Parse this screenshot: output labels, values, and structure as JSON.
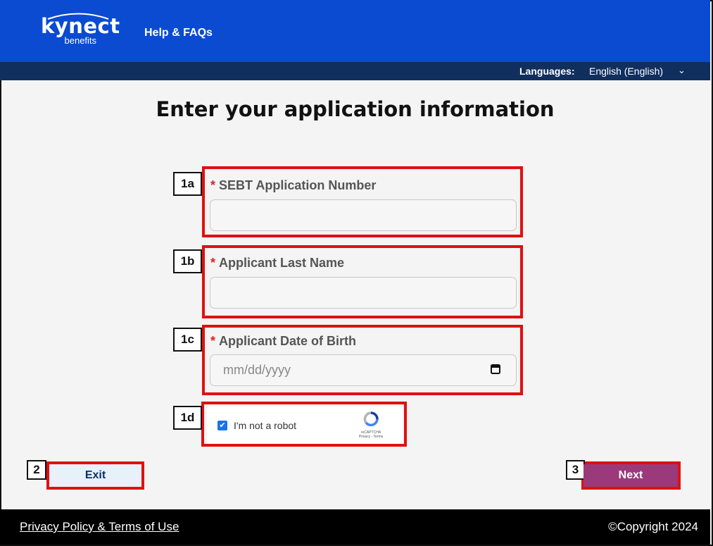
{
  "header": {
    "logo_main": "kynect",
    "logo_sub": "benefits",
    "help_link": "Help & FAQs"
  },
  "language_bar": {
    "label": "Languages:",
    "value": "English (English)",
    "icon": "chevron-down-icon"
  },
  "page": {
    "title": "Enter your application information"
  },
  "form": {
    "required_mark": "*",
    "fields": [
      {
        "badge": "1a",
        "label": "SEBT Application Number",
        "value": "",
        "placeholder": ""
      },
      {
        "badge": "1b",
        "label": "Applicant Last Name",
        "value": "",
        "placeholder": ""
      },
      {
        "badge": "1c",
        "label": "Applicant Date of Birth",
        "value": "",
        "placeholder": "mm/dd/yyyy",
        "icon": "calendar-icon"
      }
    ],
    "captcha": {
      "badge": "1d",
      "checked": true,
      "label": "I'm not a robot",
      "brand": "reCAPTCHA",
      "links": "Privacy - Terms"
    }
  },
  "actions": {
    "exit": {
      "badge": "2",
      "label": "Exit"
    },
    "next": {
      "badge": "3",
      "label": "Next"
    }
  },
  "footer": {
    "privacy_link": "Privacy Policy & Terms of Use",
    "copyright": "©Copyright 2024"
  },
  "colors": {
    "header_blue": "#0a4bd2",
    "lang_bar_navy": "#102f5f",
    "annotation_red": "#e01010",
    "next_button": "#9a3a7a",
    "exit_button": "#e8f0fa",
    "footer_black": "#000000"
  }
}
